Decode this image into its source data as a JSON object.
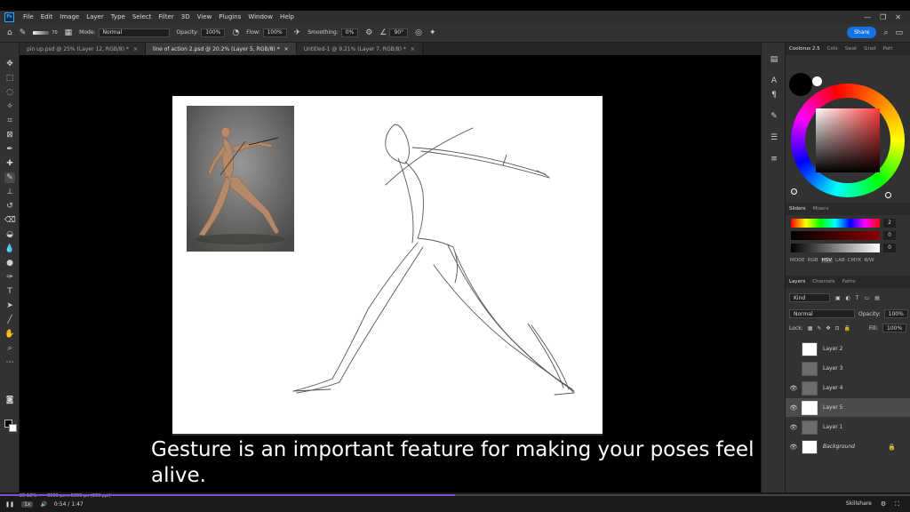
{
  "menu": {
    "logo": "Ps",
    "items": [
      "File",
      "Edit",
      "Image",
      "Layer",
      "Type",
      "Select",
      "Filter",
      "3D",
      "View",
      "Plugins",
      "Window",
      "Help"
    ],
    "win_min": "—",
    "win_max": "❐",
    "win_close": "✕"
  },
  "options": {
    "brush_size": "70",
    "mode_label": "Mode:",
    "mode_value": "Normal",
    "opacity_label": "Opacity:",
    "opacity_value": "100%",
    "flow_label": "Flow:",
    "flow_value": "100%",
    "smoothing_label": "Smoothing:",
    "smoothing_value": "0%",
    "angle_value": "90°",
    "share_label": "Share"
  },
  "tabs": [
    {
      "label": "pin up.psd @ 25% (Layer 12, RGB/8) *",
      "active": false
    },
    {
      "label": "line of action 2.psd @ 20.2% (Layer 5, RGB/8) *",
      "active": true
    },
    {
      "label": "Untitled-1 @ 9.21% (Layer 7, RGB/8) *",
      "active": false
    }
  ],
  "tab_close": "×",
  "panels": {
    "color_tabs": [
      "Coolorus 2.5",
      "Colo",
      "Swat",
      "Grad",
      "Patt"
    ],
    "sliders_tabs": [
      "Sliders",
      "Mixers"
    ],
    "slider_values": [
      "2",
      "0",
      "0"
    ],
    "modes": [
      "MODE",
      "RGB",
      "HSV",
      "LAB",
      "CMYK",
      "B/W"
    ],
    "selected_mode": "HSV",
    "layer_tabs": [
      "Layers",
      "Channels",
      "Paths"
    ],
    "kind_label": "Kind",
    "blend_mode": "Normal",
    "opacity_label": "Opacity:",
    "opacity_value": "100%",
    "lock_label": "Lock:",
    "fill_label": "Fill:",
    "fill_value": "100%"
  },
  "layers": [
    {
      "name": "Layer 2",
      "visible": false,
      "selected": false
    },
    {
      "name": "Layer 3",
      "visible": false,
      "selected": false
    },
    {
      "name": "Layer 4",
      "visible": true,
      "selected": false
    },
    {
      "name": "Layer 5",
      "visible": true,
      "selected": true
    },
    {
      "name": "Layer 1",
      "visible": true,
      "selected": false
    },
    {
      "name": "Background",
      "visible": true,
      "selected": false
    }
  ],
  "status": {
    "zoom": "20.18%",
    "doc_size": "6000 px x 5000 px (300 ppi)"
  },
  "player": {
    "speed": "1x",
    "time": "0:54 / 1:47",
    "progress": 0.5,
    "watermark": "Skillshare"
  },
  "caption": {
    "line1": "Gesture is an important feature for making your poses feel",
    "line2": "alive."
  },
  "colors": {
    "accent": "#1473e6",
    "progress": "#8a4bd0",
    "panel_bg": "#323232",
    "canvas_bg": "#000000"
  }
}
